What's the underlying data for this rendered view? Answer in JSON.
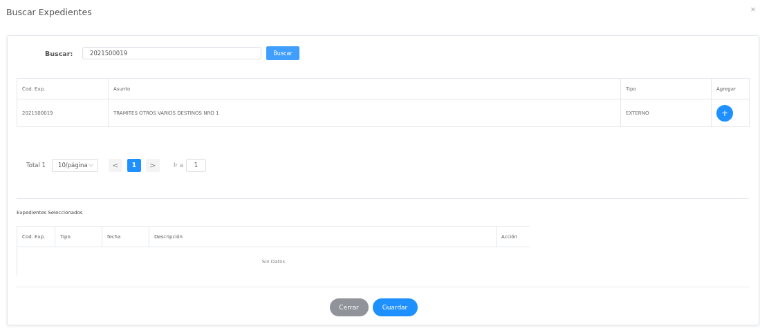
{
  "dialog": {
    "title": "Buscar Expedientes",
    "close": "×"
  },
  "search": {
    "label": "Buscar:",
    "value": "2021500019",
    "button": "Buscar"
  },
  "results": {
    "columns": [
      "Cod. Exp.",
      "Asunto",
      "Tipo",
      "Agregar"
    ],
    "rows": [
      {
        "cells": [
          "2021500019",
          "TRAMITES OTROS VARIOS DESTINOS NRO 1",
          "EXTERNO"
        ],
        "add": "+"
      }
    ]
  },
  "pagination": {
    "total": "Total 1",
    "page_size": "10/página",
    "prev": {
      "label": "<",
      "disabled": true
    },
    "pages": [
      {
        "label": "1",
        "selected": true
      }
    ],
    "next": {
      "label": ">",
      "disabled": true
    },
    "goto_label": "Ir a",
    "goto_value": "1"
  },
  "selected_section": {
    "title": "Expedientes Seleccionados",
    "columns": [
      "Cod. Exp.",
      "Tipo",
      "fecha",
      "Descripción",
      "Acción"
    ],
    "empty": "Sin Datos"
  },
  "footer": {
    "buttons": [
      {
        "label": "Cerrar",
        "kind": "secondary"
      },
      {
        "label": "Guardar",
        "kind": "primary"
      }
    ]
  }
}
